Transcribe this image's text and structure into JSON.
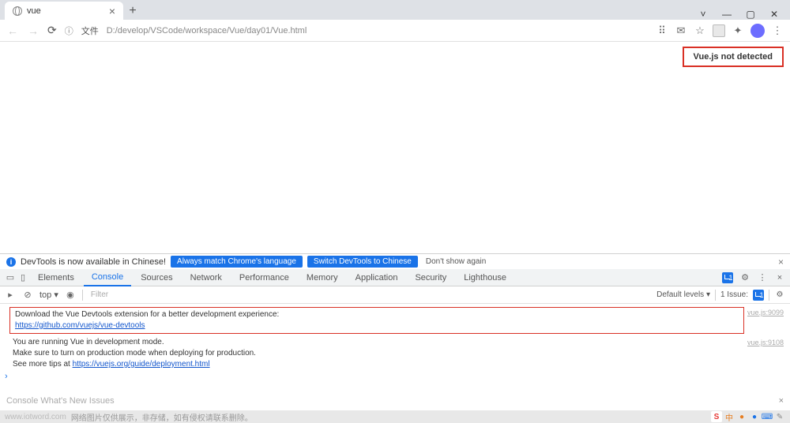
{
  "tab": {
    "title": "vue"
  },
  "addr": {
    "file_label": "文件",
    "url": "D:/develop/VSCode/workspace/Vue/day01/Vue.html"
  },
  "viewport": {
    "vue_badge": "Vue.js not detected"
  },
  "banner": {
    "text": "DevTools is now available in Chinese!",
    "btn1": "Always match Chrome's language",
    "btn2": "Switch DevTools to Chinese",
    "dont": "Don't show again"
  },
  "dt": {
    "tabs": [
      "Elements",
      "Console",
      "Sources",
      "Network",
      "Performance",
      "Memory",
      "Application",
      "Security",
      "Lighthouse"
    ],
    "active": "Console",
    "badge": "1"
  },
  "toolbar": {
    "context": "top ▾",
    "filter_ph": "Filter",
    "levels": "Default levels ▾",
    "issues_label": "1 Issue:",
    "issues_count": "1"
  },
  "console": {
    "msg1_line1": "Download the Vue Devtools extension for a better development experience:",
    "msg1_link": "https://github.com/vuejs/vue-devtools",
    "src1": "vue.js:9099",
    "msg2_line1": "You are running Vue in development mode.",
    "msg2_line2": "Make sure to turn on production mode when deploying for production.",
    "msg2_line3a": "See more tips at ",
    "msg2_link": "https://vuejs.org/guide/deployment.html",
    "src2": "vue.js:9108"
  },
  "footer": {
    "left": "Console   What's New   Issues",
    "wm": "网络图片仅供展示，非存储，如有侵权请联系删除。",
    "wm_host": "www.iotword.com"
  }
}
